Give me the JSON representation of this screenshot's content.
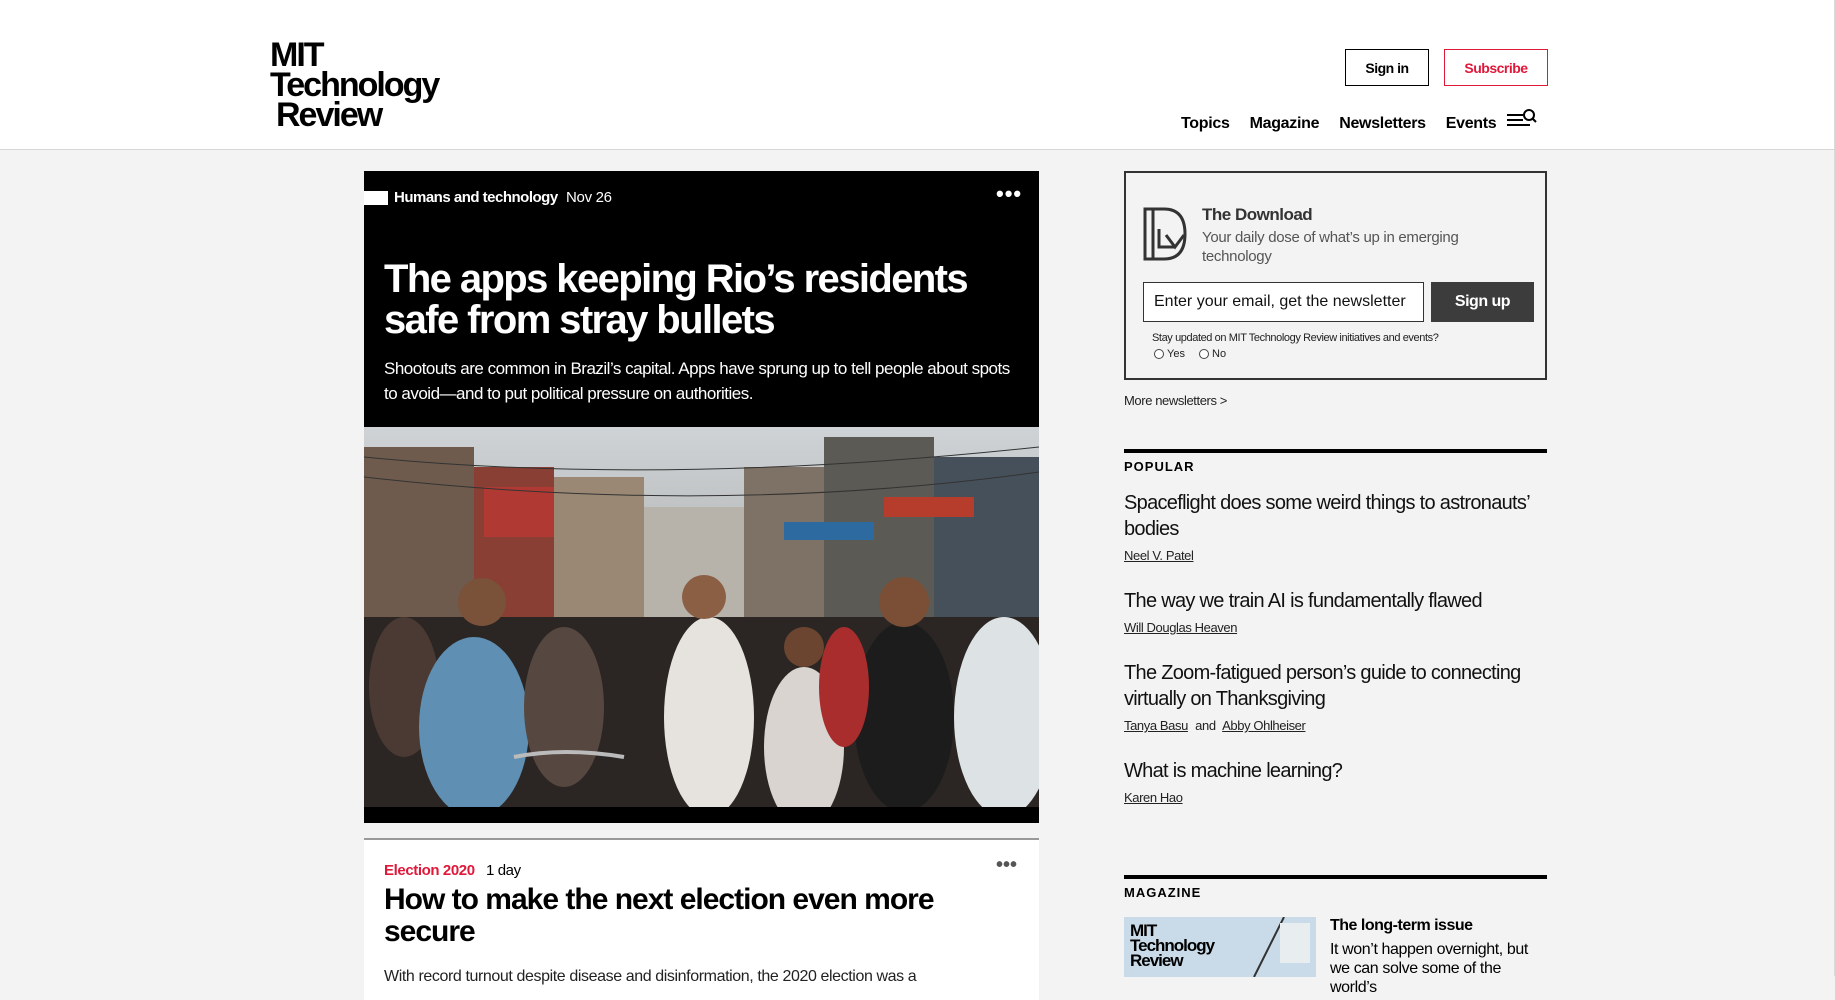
{
  "header": {
    "logo_lines": [
      "MIT",
      "Technology",
      "Review"
    ],
    "signin_label": "Sign in",
    "subscribe_label": "Subscribe",
    "nav": [
      "Topics",
      "Magazine",
      "Newsletters",
      "Events"
    ],
    "menu_icon": "menu-search-icon"
  },
  "feature": {
    "topic": "Humans and technology",
    "date": "Nov 26",
    "more_icon": "more-dots-icon",
    "title": "The apps keeping Rio’s residents safe from stray bullets",
    "dek": "Shootouts are common in Brazil’s capital. Apps have sprung up to tell people about spots to avoid—and to put political pressure on authorities."
  },
  "story2": {
    "topic": "Election 2020",
    "date": "1 day",
    "title": "How to make the next election even more secure",
    "dek": "With record turnout despite disease and disinformation, the 2020 election was a"
  },
  "newsletter": {
    "title": "The Download",
    "description": "Your daily dose of what’s up in emerging technology",
    "email_placeholder": "Enter your email, get the newsletter",
    "signup_label": "Sign up",
    "consent_text": "Stay updated on MIT Technology Review initiatives and events?",
    "yes_label": "Yes",
    "no_label": "No",
    "more_link": "More newsletters >"
  },
  "popular": {
    "label": "POPULAR",
    "items": [
      {
        "title": "Spaceflight does some weird things to astronauts’ bodies",
        "author1": "Neel V. Patel",
        "and": "",
        "author2": ""
      },
      {
        "title": "The way we train AI is fundamentally flawed",
        "author1": "Will Douglas Heaven",
        "and": "",
        "author2": ""
      },
      {
        "title": "The Zoom-fatigued person’s guide to connecting virtually on Thanksgiving",
        "author1": "Tanya Basu",
        "and": "and",
        "author2": "Abby Ohlheiser"
      },
      {
        "title": "What is machine learning?",
        "author1": "Karen Hao",
        "and": "",
        "author2": ""
      }
    ]
  },
  "magazine": {
    "label": "MAGAZINE",
    "thumb_lines": [
      "MIT",
      "Technology",
      "Review"
    ],
    "title": "The long-term issue",
    "desc": "It won’t happen overnight, but we can solve some of the world’s"
  },
  "colors": {
    "accent_red": "#e0183a",
    "feature_bg": "#000000",
    "page_bg": "#f3f3f3"
  }
}
